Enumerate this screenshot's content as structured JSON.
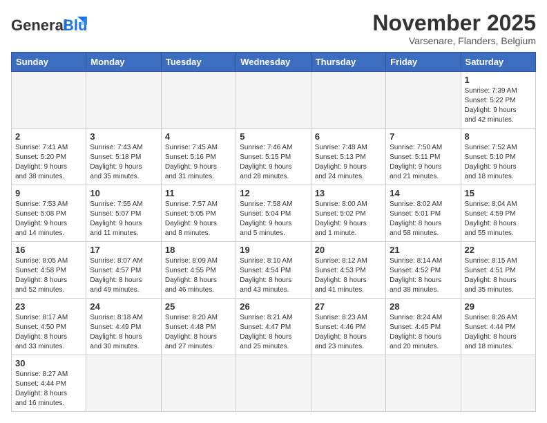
{
  "header": {
    "logo_general": "General",
    "logo_blue": "Blue",
    "month_title": "November 2025",
    "location": "Varsenare, Flanders, Belgium"
  },
  "weekdays": [
    "Sunday",
    "Monday",
    "Tuesday",
    "Wednesday",
    "Thursday",
    "Friday",
    "Saturday"
  ],
  "weeks": [
    [
      {
        "day": "",
        "info": ""
      },
      {
        "day": "",
        "info": ""
      },
      {
        "day": "",
        "info": ""
      },
      {
        "day": "",
        "info": ""
      },
      {
        "day": "",
        "info": ""
      },
      {
        "day": "",
        "info": ""
      },
      {
        "day": "1",
        "info": "Sunrise: 7:39 AM\nSunset: 5:22 PM\nDaylight: 9 hours\nand 42 minutes."
      }
    ],
    [
      {
        "day": "2",
        "info": "Sunrise: 7:41 AM\nSunset: 5:20 PM\nDaylight: 9 hours\nand 38 minutes."
      },
      {
        "day": "3",
        "info": "Sunrise: 7:43 AM\nSunset: 5:18 PM\nDaylight: 9 hours\nand 35 minutes."
      },
      {
        "day": "4",
        "info": "Sunrise: 7:45 AM\nSunset: 5:16 PM\nDaylight: 9 hours\nand 31 minutes."
      },
      {
        "day": "5",
        "info": "Sunrise: 7:46 AM\nSunset: 5:15 PM\nDaylight: 9 hours\nand 28 minutes."
      },
      {
        "day": "6",
        "info": "Sunrise: 7:48 AM\nSunset: 5:13 PM\nDaylight: 9 hours\nand 24 minutes."
      },
      {
        "day": "7",
        "info": "Sunrise: 7:50 AM\nSunset: 5:11 PM\nDaylight: 9 hours\nand 21 minutes."
      },
      {
        "day": "8",
        "info": "Sunrise: 7:52 AM\nSunset: 5:10 PM\nDaylight: 9 hours\nand 18 minutes."
      }
    ],
    [
      {
        "day": "9",
        "info": "Sunrise: 7:53 AM\nSunset: 5:08 PM\nDaylight: 9 hours\nand 14 minutes."
      },
      {
        "day": "10",
        "info": "Sunrise: 7:55 AM\nSunset: 5:07 PM\nDaylight: 9 hours\nand 11 minutes."
      },
      {
        "day": "11",
        "info": "Sunrise: 7:57 AM\nSunset: 5:05 PM\nDaylight: 9 hours\nand 8 minutes."
      },
      {
        "day": "12",
        "info": "Sunrise: 7:58 AM\nSunset: 5:04 PM\nDaylight: 9 hours\nand 5 minutes."
      },
      {
        "day": "13",
        "info": "Sunrise: 8:00 AM\nSunset: 5:02 PM\nDaylight: 9 hours\nand 1 minute."
      },
      {
        "day": "14",
        "info": "Sunrise: 8:02 AM\nSunset: 5:01 PM\nDaylight: 8 hours\nand 58 minutes."
      },
      {
        "day": "15",
        "info": "Sunrise: 8:04 AM\nSunset: 4:59 PM\nDaylight: 8 hours\nand 55 minutes."
      }
    ],
    [
      {
        "day": "16",
        "info": "Sunrise: 8:05 AM\nSunset: 4:58 PM\nDaylight: 8 hours\nand 52 minutes."
      },
      {
        "day": "17",
        "info": "Sunrise: 8:07 AM\nSunset: 4:57 PM\nDaylight: 8 hours\nand 49 minutes."
      },
      {
        "day": "18",
        "info": "Sunrise: 8:09 AM\nSunset: 4:55 PM\nDaylight: 8 hours\nand 46 minutes."
      },
      {
        "day": "19",
        "info": "Sunrise: 8:10 AM\nSunset: 4:54 PM\nDaylight: 8 hours\nand 43 minutes."
      },
      {
        "day": "20",
        "info": "Sunrise: 8:12 AM\nSunset: 4:53 PM\nDaylight: 8 hours\nand 41 minutes."
      },
      {
        "day": "21",
        "info": "Sunrise: 8:14 AM\nSunset: 4:52 PM\nDaylight: 8 hours\nand 38 minutes."
      },
      {
        "day": "22",
        "info": "Sunrise: 8:15 AM\nSunset: 4:51 PM\nDaylight: 8 hours\nand 35 minutes."
      }
    ],
    [
      {
        "day": "23",
        "info": "Sunrise: 8:17 AM\nSunset: 4:50 PM\nDaylight: 8 hours\nand 33 minutes."
      },
      {
        "day": "24",
        "info": "Sunrise: 8:18 AM\nSunset: 4:49 PM\nDaylight: 8 hours\nand 30 minutes."
      },
      {
        "day": "25",
        "info": "Sunrise: 8:20 AM\nSunset: 4:48 PM\nDaylight: 8 hours\nand 27 minutes."
      },
      {
        "day": "26",
        "info": "Sunrise: 8:21 AM\nSunset: 4:47 PM\nDaylight: 8 hours\nand 25 minutes."
      },
      {
        "day": "27",
        "info": "Sunrise: 8:23 AM\nSunset: 4:46 PM\nDaylight: 8 hours\nand 23 minutes."
      },
      {
        "day": "28",
        "info": "Sunrise: 8:24 AM\nSunset: 4:45 PM\nDaylight: 8 hours\nand 20 minutes."
      },
      {
        "day": "29",
        "info": "Sunrise: 8:26 AM\nSunset: 4:44 PM\nDaylight: 8 hours\nand 18 minutes."
      }
    ],
    [
      {
        "day": "30",
        "info": "Sunrise: 8:27 AM\nSunset: 4:44 PM\nDaylight: 8 hours\nand 16 minutes."
      },
      {
        "day": "",
        "info": ""
      },
      {
        "day": "",
        "info": ""
      },
      {
        "day": "",
        "info": ""
      },
      {
        "day": "",
        "info": ""
      },
      {
        "day": "",
        "info": ""
      },
      {
        "day": "",
        "info": ""
      }
    ]
  ]
}
